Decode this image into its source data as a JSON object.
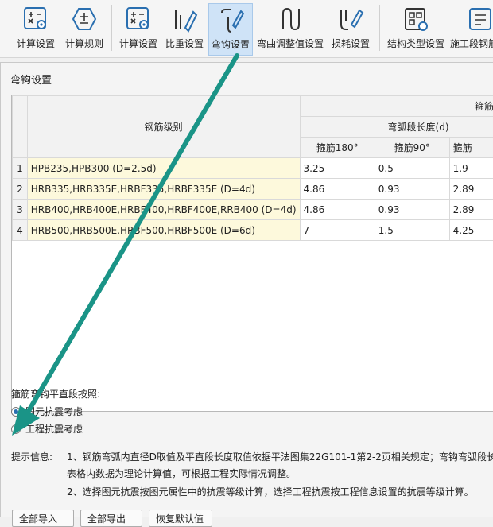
{
  "toolbar": {
    "groups": [
      [
        {
          "label": "计算设置",
          "icon": "calc-settings-icon"
        },
        {
          "label": "计算规则",
          "icon": "calc-rules-icon"
        }
      ],
      [
        {
          "label": "计算设置",
          "icon": "calc-settings-icon"
        },
        {
          "label": "比重设置",
          "icon": "rebar-weight-icon"
        },
        {
          "label": "弯钩设置",
          "icon": "hook-settings-icon",
          "active": true
        },
        {
          "label": "弯曲调整值设置",
          "icon": "bend-adjust-icon"
        },
        {
          "label": "损耗设置",
          "icon": "loss-settings-icon"
        }
      ],
      [
        {
          "label": "结构类型设置",
          "icon": "structure-type-icon"
        },
        {
          "label": "施工段钢筋",
          "icon": "construction-rebar-icon"
        }
      ]
    ]
  },
  "dialog": {
    "title": "弯钩设置",
    "table": {
      "header_top": "箍筋",
      "header_group": "弯弧段长度(d)",
      "grade_header": "钢筋级别",
      "sub_headers": [
        "箍筋180°",
        "箍筋90°",
        "箍筋"
      ],
      "rows": [
        {
          "no": "1",
          "grade": "HPB235,HPB300 (D=2.5d)",
          "v1": "3.25",
          "v2": "0.5",
          "v3": "1.9"
        },
        {
          "no": "2",
          "grade": "HRB335,HRB335E,HRBF335,HRBF335E (D=4d)",
          "v1": "4.86",
          "v2": "0.93",
          "v3": "2.89"
        },
        {
          "no": "3",
          "grade": "HRB400,HRB400E,HRBF400,HRBF400E,RRB400 (D=4d)",
          "v1": "4.86",
          "v2": "0.93",
          "v3": "2.89"
        },
        {
          "no": "4",
          "grade": "HRB500,HRB500E,HRBF500,HRBF500E (D=6d)",
          "v1": "7",
          "v2": "1.5",
          "v3": "4.25"
        }
      ]
    },
    "section_label": "箍筋弯钩平直段按照:",
    "options": [
      {
        "label": "图元抗震考虑",
        "checked": true
      },
      {
        "label": "工程抗震考虑",
        "checked": false
      }
    ],
    "tips_label": "提示信息:",
    "tips": [
      "1、钢筋弯弧内直径D取值及平直段长度取值依据平法图集22G101-1第2-2页相关规定；弯钩弯弧段长",
      "表格内数据为理论计算值，可根据工程实际情况调整。",
      "2、选择图元抗震按图元属性中的抗震等级计算，选择工程抗震按工程信息设置的抗震等级计算。"
    ],
    "buttons": [
      "全部导入",
      "全部导出",
      "恢复默认值"
    ]
  },
  "colors": {
    "accent": "#2a6fb0",
    "highlight_cell": "#fdf9dc",
    "annotation_arrow": "#1a9487"
  }
}
